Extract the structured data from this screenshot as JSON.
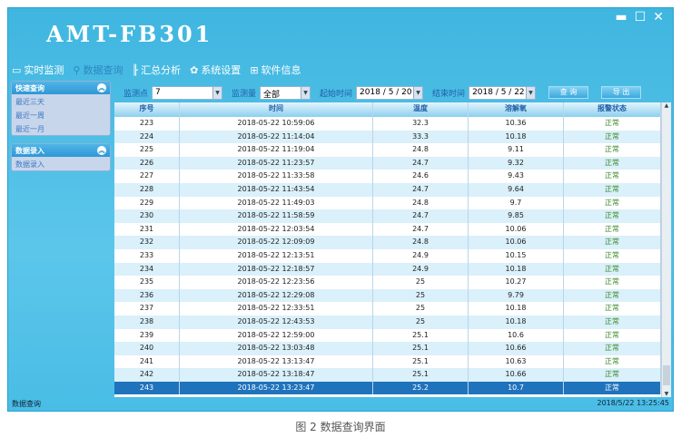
{
  "app": {
    "title": "AMT-FB301",
    "minimize": "▬",
    "maximize": "☐",
    "close": "✕"
  },
  "menu": [
    {
      "icon": "monitor-icon",
      "glyph": "▭",
      "label": "实时监测"
    },
    {
      "icon": "search-person-icon",
      "glyph": "⚲",
      "label": "数据查询"
    },
    {
      "icon": "chart-icon",
      "glyph": "╟",
      "label": "汇总分析"
    },
    {
      "icon": "gear-icon",
      "glyph": "✿",
      "label": "系统设置"
    },
    {
      "icon": "grid-icon",
      "glyph": "⊞",
      "label": "软件信息"
    }
  ],
  "sidebar": {
    "panels": [
      {
        "title": "快速查询",
        "items": [
          "最近三天",
          "最近一周",
          "最近一月"
        ]
      },
      {
        "title": "数据录入",
        "items": [
          "数据录入"
        ]
      }
    ]
  },
  "toolbar": {
    "point_label": "监测点",
    "point_value": "7",
    "quantity_label": "监测量",
    "quantity_value": "全部",
    "start_label": "起始时间",
    "start_value": "2018 / 5 / 20",
    "end_label": "结束时间",
    "end_value": "2018 / 5 / 22",
    "query": "查 询",
    "export": "导 出"
  },
  "table": {
    "headers": [
      "序号",
      "时间",
      "温度",
      "溶解氧",
      "报警状态"
    ],
    "rows": [
      [
        "223",
        "2018-05-22 10:59:06",
        "32.3",
        "10.36",
        "正常"
      ],
      [
        "224",
        "2018-05-22 11:14:04",
        "33.3",
        "10.18",
        "正常"
      ],
      [
        "225",
        "2018-05-22 11:19:04",
        "24.8",
        "9.11",
        "正常"
      ],
      [
        "226",
        "2018-05-22 11:23:57",
        "24.7",
        "9.32",
        "正常"
      ],
      [
        "227",
        "2018-05-22 11:33:58",
        "24.6",
        "9.43",
        "正常"
      ],
      [
        "228",
        "2018-05-22 11:43:54",
        "24.7",
        "9.64",
        "正常"
      ],
      [
        "229",
        "2018-05-22 11:49:03",
        "24.8",
        "9.7",
        "正常"
      ],
      [
        "230",
        "2018-05-22 11:58:59",
        "24.7",
        "9.85",
        "正常"
      ],
      [
        "231",
        "2018-05-22 12:03:54",
        "24.7",
        "10.06",
        "正常"
      ],
      [
        "232",
        "2018-05-22 12:09:09",
        "24.8",
        "10.06",
        "正常"
      ],
      [
        "233",
        "2018-05-22 12:13:51",
        "24.9",
        "10.15",
        "正常"
      ],
      [
        "234",
        "2018-05-22 12:18:57",
        "24.9",
        "10.18",
        "正常"
      ],
      [
        "235",
        "2018-05-22 12:23:56",
        "25",
        "10.27",
        "正常"
      ],
      [
        "236",
        "2018-05-22 12:29:08",
        "25",
        "9.79",
        "正常"
      ],
      [
        "237",
        "2018-05-22 12:33:51",
        "25",
        "10.18",
        "正常"
      ],
      [
        "238",
        "2018-05-22 12:43:53",
        "25",
        "10.18",
        "正常"
      ],
      [
        "239",
        "2018-05-22 12:59:00",
        "25.1",
        "10.6",
        "正常"
      ],
      [
        "240",
        "2018-05-22 13:03:48",
        "25.1",
        "10.66",
        "正常"
      ],
      [
        "241",
        "2018-05-22 13:13:47",
        "25.1",
        "10.63",
        "正常"
      ],
      [
        "242",
        "2018-05-22 13:18:47",
        "25.1",
        "10.66",
        "正常"
      ],
      [
        "243",
        "2018-05-22 13:23:47",
        "25.2",
        "10.7",
        "正常"
      ]
    ],
    "selected_row": "243"
  },
  "status": {
    "left": "数据查询",
    "right": "2018/5/22 13:25:45"
  },
  "caption": "图 2 数据查询界面"
}
